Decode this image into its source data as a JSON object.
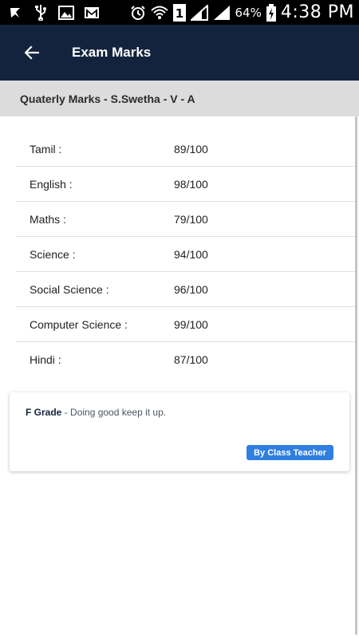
{
  "status_bar": {
    "battery_percent": "64%",
    "time": "4:38 PM",
    "icons": [
      "notification-icon",
      "usb-icon",
      "image-icon",
      "gmail-icon",
      "alarm-icon",
      "wifi-icon",
      "sim-1-icon",
      "signal-icon",
      "signal-icon",
      "battery-charging-icon"
    ]
  },
  "app_bar": {
    "back_icon": "arrow-back-icon",
    "title": "Exam Marks",
    "color": "#14233d"
  },
  "subheader": {
    "title": "Quaterly Marks - S.Swetha - V - A"
  },
  "marks": [
    {
      "subject": "Tamil :",
      "score": "89/100"
    },
    {
      "subject": "English :",
      "score": "98/100"
    },
    {
      "subject": "Maths :",
      "score": "79/100"
    },
    {
      "subject": "Science :",
      "score": "94/100"
    },
    {
      "subject": "Social Science :",
      "score": "96/100"
    },
    {
      "subject": "Computer Science :",
      "score": "99/100"
    },
    {
      "subject": "Hindi :",
      "score": "87/100"
    }
  ],
  "remark": {
    "grade": "F Grade",
    "comment": " - Doing good keep it up.",
    "badge": "By Class Teacher",
    "badge_color": "#2f7fe0"
  }
}
